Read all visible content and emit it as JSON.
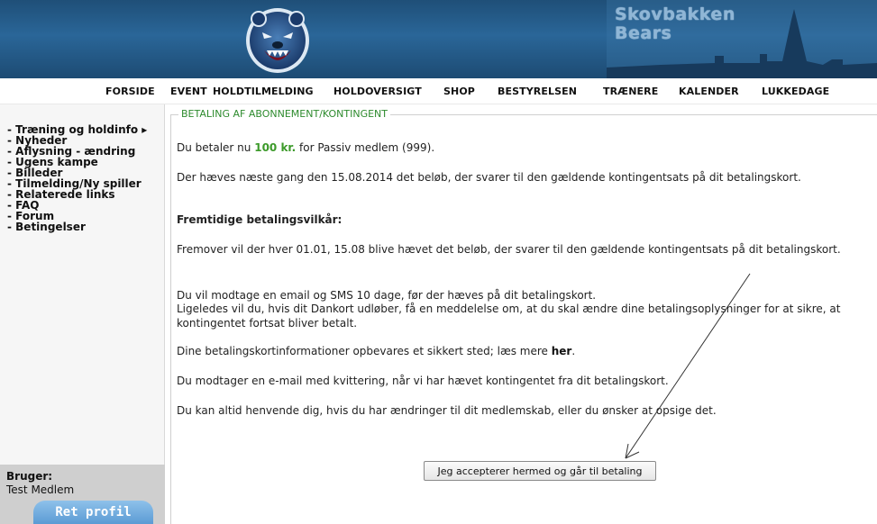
{
  "banner": {
    "brand_line1": "Skovbakken",
    "brand_line2": "Bears",
    "logo_icon": "bear-head-logo-icon",
    "colors": {
      "sky": "#2a6698",
      "brand_text": "#8fb6d6"
    }
  },
  "topnav": {
    "items": [
      "FORSIDE",
      "EVENT",
      "HOLDTILMELDING",
      "HOLDOVERSIGT",
      "SHOP",
      "BESTYRELSEN",
      "TRÆNERE",
      "KALENDER",
      "LUKKEDAGE"
    ]
  },
  "sidebar": {
    "items": [
      "- Træning og holdinfo ▸",
      "- Nyheder",
      "- Aflysning - ændring",
      "- Ugens kampe",
      "- Billeder",
      "- Tilmelding/Ny spiller",
      "- Relaterede links",
      "- FAQ",
      "- Forum",
      "- Betingelser"
    ],
    "user_label": "Bruger:",
    "user_name": "Test Medlem",
    "profile_button": "Ret profil"
  },
  "main": {
    "legend": "BETALING AF ABONNEMENT/KONTINGENT",
    "line1_pre": "Du betaler nu ",
    "line1_amount": "100 kr.",
    "line1_post": " for Passiv medlem (999).",
    "line2": "Der hæves næste gang den 15.08.2014 det beløb, der svarer til den gældende kontingentsats på dit betalingskort.",
    "future_heading": "Fremtidige betalingsvilkår:",
    "future_text": "Fremover vil der hver 01.01, 15.08 blive hævet det beløb, der svarer til den gældende kontingentsats på dit betalingskort.",
    "notice1": "Du vil modtage en email og SMS 10 dage, før der hæves på dit betalingskort.",
    "notice2": "Ligeledes vil du, hvis dit Dankort udløber, få en meddelelse om, at du skal ændre dine betalingsoplysninger for at sikre, at kontingentet fortsat bliver betalt.",
    "storage_pre": "Dine betalingskortinformationer opbevares et sikkert sted; læs mere ",
    "storage_link": "her",
    "storage_post": ".",
    "receipt": "Du modtager en e-mail med kvittering, når vi har hævet kontingentet fra dit betalingskort.",
    "contact": "Du kan altid henvende dig, hvis du har ændringer til dit medlemskab, eller du ønsker at opsige det.",
    "accept_button": "Jeg accepterer hermed og går til betaling"
  },
  "annotation": {
    "arrow_color": "#333333"
  }
}
